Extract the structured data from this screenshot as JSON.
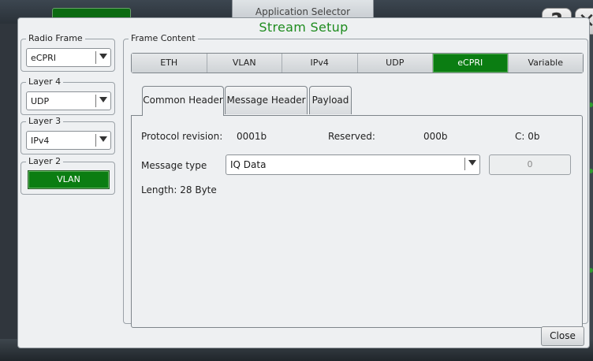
{
  "background": {
    "app_selector_label": "Application Selector"
  },
  "dialog": {
    "title": "Stream Setup",
    "close_label": "Close",
    "help_glyph": "?",
    "x_glyph": "✕"
  },
  "radio_frame": {
    "legend": "Radio Frame",
    "value": "eCPRI"
  },
  "layer4": {
    "legend": "Layer 4",
    "value": "UDP"
  },
  "layer3": {
    "legend": "Layer 3",
    "value": "IPv4"
  },
  "layer2": {
    "legend": "Layer 2",
    "button_label": "VLAN"
  },
  "frame_content": {
    "legend": "Frame Content",
    "protocol_tabs": [
      {
        "label": "ETH",
        "active": false
      },
      {
        "label": "VLAN",
        "active": false
      },
      {
        "label": "IPv4",
        "active": false
      },
      {
        "label": "UDP",
        "active": false
      },
      {
        "label": "eCPRI",
        "active": true
      },
      {
        "label": "Variable",
        "active": false
      }
    ],
    "inner_tabs": [
      {
        "label": "Common Header",
        "active": true
      },
      {
        "label": "Message Header",
        "active": false
      },
      {
        "label": "Payload",
        "active": false
      }
    ],
    "common_header": {
      "protocol_revision_label": "Protocol revision:",
      "protocol_revision_value": "0001b",
      "reserved_label": "Reserved:",
      "reserved_value": "000b",
      "c_value": "C: 0b",
      "message_type_label": "Message type",
      "message_type_value": "IQ Data",
      "message_type_code": "0",
      "length_text": "Length: 28 Byte"
    }
  },
  "colors": {
    "active_green": "#0b7d12",
    "title_green": "#1f8c1f"
  }
}
